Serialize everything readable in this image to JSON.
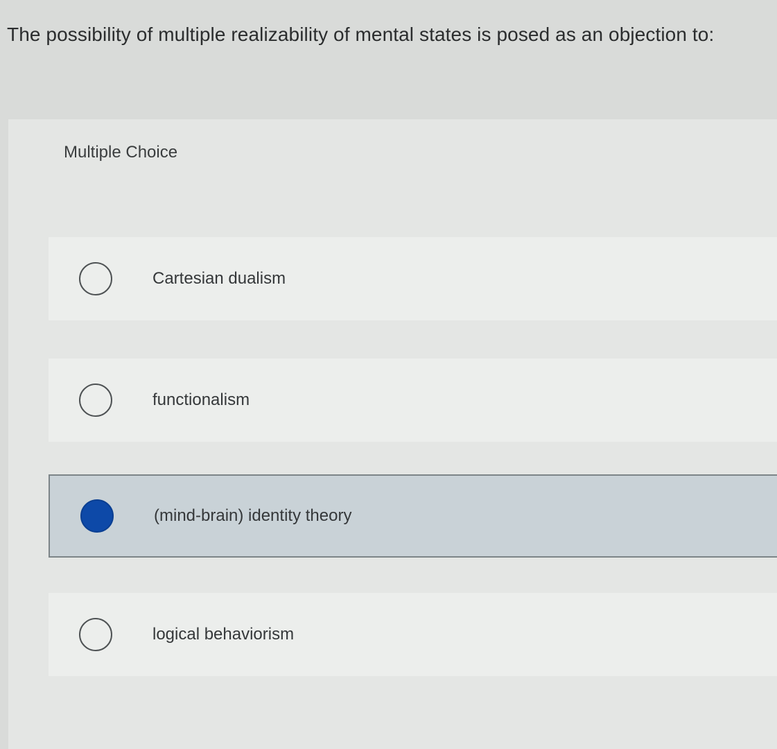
{
  "question": {
    "text": "The possibility of multiple realizability of mental states is posed as an objection to:"
  },
  "panel": {
    "type_label": "Multiple Choice"
  },
  "options": [
    {
      "label": "Cartesian dualism",
      "selected": false
    },
    {
      "label": "functionalism",
      "selected": false
    },
    {
      "label": "(mind-brain) identity theory",
      "selected": true
    },
    {
      "label": "logical behaviorism",
      "selected": false
    }
  ],
  "colors": {
    "selected_radio": "#0d49a8",
    "selected_background": "#c9d2d7",
    "page_background": "#d9dbd9"
  }
}
